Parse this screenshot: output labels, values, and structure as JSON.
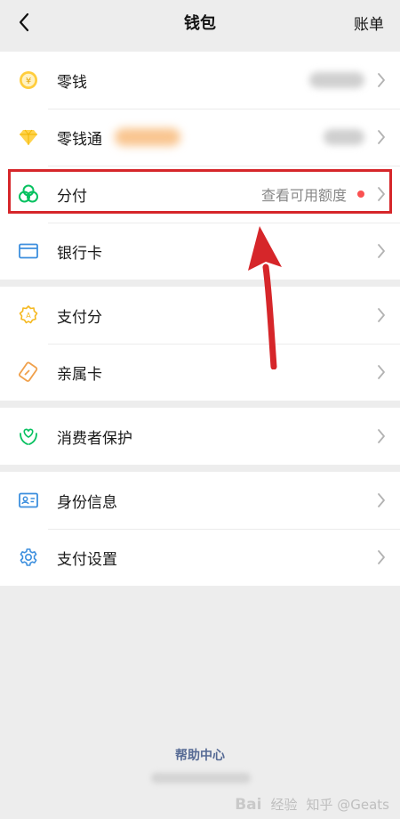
{
  "nav": {
    "title": "钱包",
    "bill": "账单"
  },
  "groups": [
    {
      "items": [
        {
          "label": "零钱",
          "icon": "yuan-coin-icon"
        },
        {
          "label": "零钱通",
          "icon": "diamond-icon"
        },
        {
          "label": "分付",
          "icon": "fenfu-icon",
          "value": "查看可用额度"
        },
        {
          "label": "银行卡",
          "icon": "bank-card-icon"
        }
      ]
    },
    {
      "items": [
        {
          "label": "支付分",
          "icon": "pay-score-icon"
        },
        {
          "label": "亲属卡",
          "icon": "family-card-icon"
        }
      ]
    },
    {
      "items": [
        {
          "label": "消费者保护",
          "icon": "consumer-protection-icon"
        }
      ]
    },
    {
      "items": [
        {
          "label": "身份信息",
          "icon": "id-card-icon"
        },
        {
          "label": "支付设置",
          "icon": "settings-gear-icon"
        }
      ]
    }
  ],
  "footer": {
    "help": "帮助中心"
  },
  "watermark": {
    "left": "Bai",
    "middle": "经验",
    "right": "知乎 @Geats"
  },
  "colors": {
    "accent_green": "#07c160",
    "link_blue": "#576b95",
    "alert_red": "#fa5151",
    "annotation_red": "#d6262a"
  }
}
